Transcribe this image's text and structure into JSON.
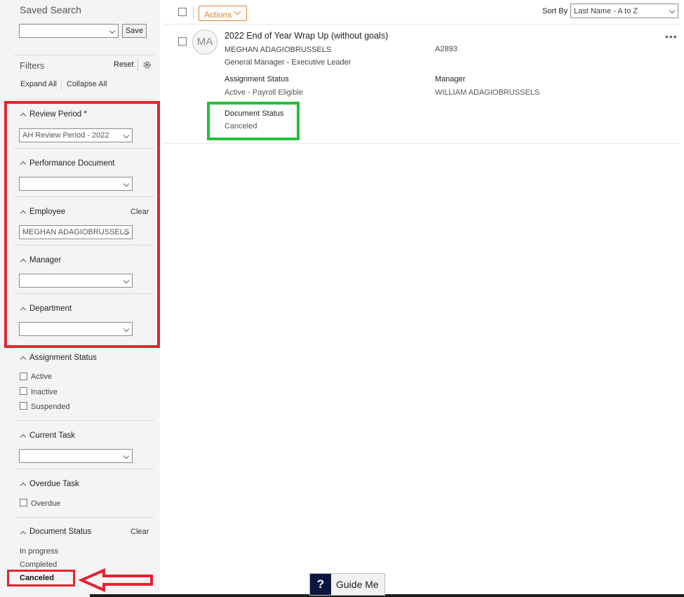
{
  "sidebar": {
    "saved_search_label": "Saved Search",
    "saved_search_value": "",
    "save_label": "Save",
    "filters_label": "Filters",
    "reset_label": "Reset",
    "expand_all": "Expand All",
    "collapse_all": "Collapse All",
    "clear_label": "Clear",
    "review_period": {
      "label": "Review Period *",
      "value": "AH Review Period - 2022"
    },
    "performance_document": {
      "label": "Performance Document",
      "value": ""
    },
    "employee": {
      "label": "Employee",
      "value": "MEGHAN ADAGIOBRUSSELS"
    },
    "manager": {
      "label": "Manager",
      "value": ""
    },
    "department": {
      "label": "Department",
      "value": ""
    },
    "assignment_status": {
      "label": "Assignment Status",
      "options": [
        "Active",
        "Inactive",
        "Suspended"
      ]
    },
    "current_task": {
      "label": "Current Task",
      "value": ""
    },
    "overdue_task": {
      "label": "Overdue Task",
      "option": "Overdue"
    },
    "document_status": {
      "label": "Document Status",
      "options": [
        "In progress",
        "Completed",
        "Canceled"
      ]
    }
  },
  "toolbar": {
    "actions_label": "Actions",
    "sort_by_label": "Sort By",
    "sort_value": "Last Name - A to Z"
  },
  "record": {
    "initials": "MA",
    "title": "2022 End of Year Wrap Up (without goals)",
    "employee_name": "MEGHAN ADAGIOBRUSSELS",
    "employee_id": "A2893",
    "job_title": "General Manager - Executive Leader",
    "assignment_status_label": "Assignment Status",
    "assignment_status_value": "Active - Payroll Eligible",
    "manager_label": "Manager",
    "manager_value": "WILLIAM ADAGIOBRUSSELS",
    "document_status_label": "Document Status",
    "document_status_value": "Canceled",
    "more_icon": "more-horizontal-icon"
  },
  "guide": {
    "icon_text": "?",
    "label": "Guide Me"
  },
  "colors": {
    "highlight_red": "#e3232f",
    "highlight_green": "#1fc23a",
    "actions_orange": "#d9862b"
  }
}
